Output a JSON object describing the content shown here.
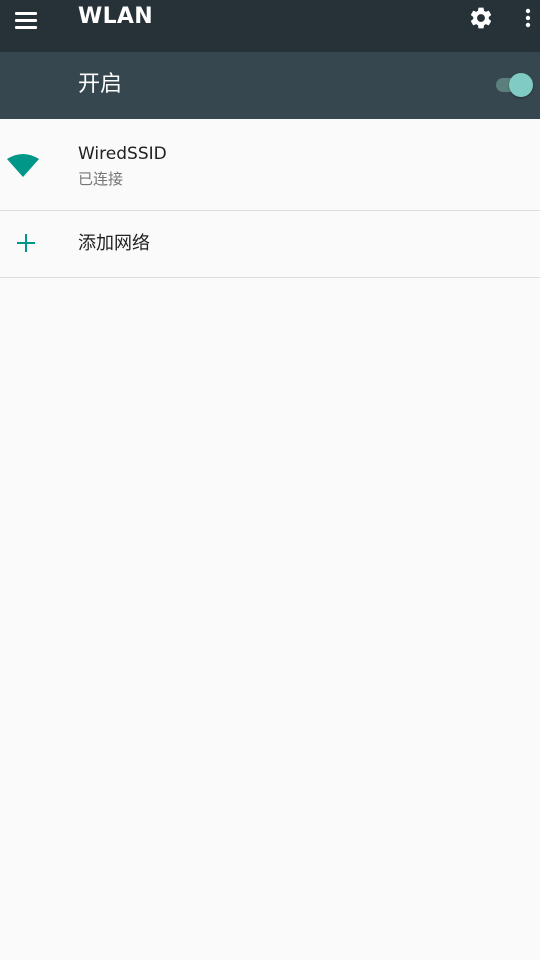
{
  "appbar": {
    "title": "WLAN",
    "menu_icon": "hamburger-menu-icon",
    "settings_icon": "gear-icon",
    "overflow_icon": "more-vert-icon"
  },
  "switch_bar": {
    "label": "开启",
    "enabled": true
  },
  "networks": [
    {
      "ssid": "WiredSSID",
      "status": "已连接",
      "icon": "wifi-signal-icon"
    }
  ],
  "add_network": {
    "label": "添加网络",
    "icon": "plus-icon"
  },
  "colors": {
    "appbar_bg": "#263238",
    "switchbar_bg": "#37474f",
    "accent": "#009688",
    "toggle_thumb": "#80cbc4",
    "background": "#fafafa"
  }
}
